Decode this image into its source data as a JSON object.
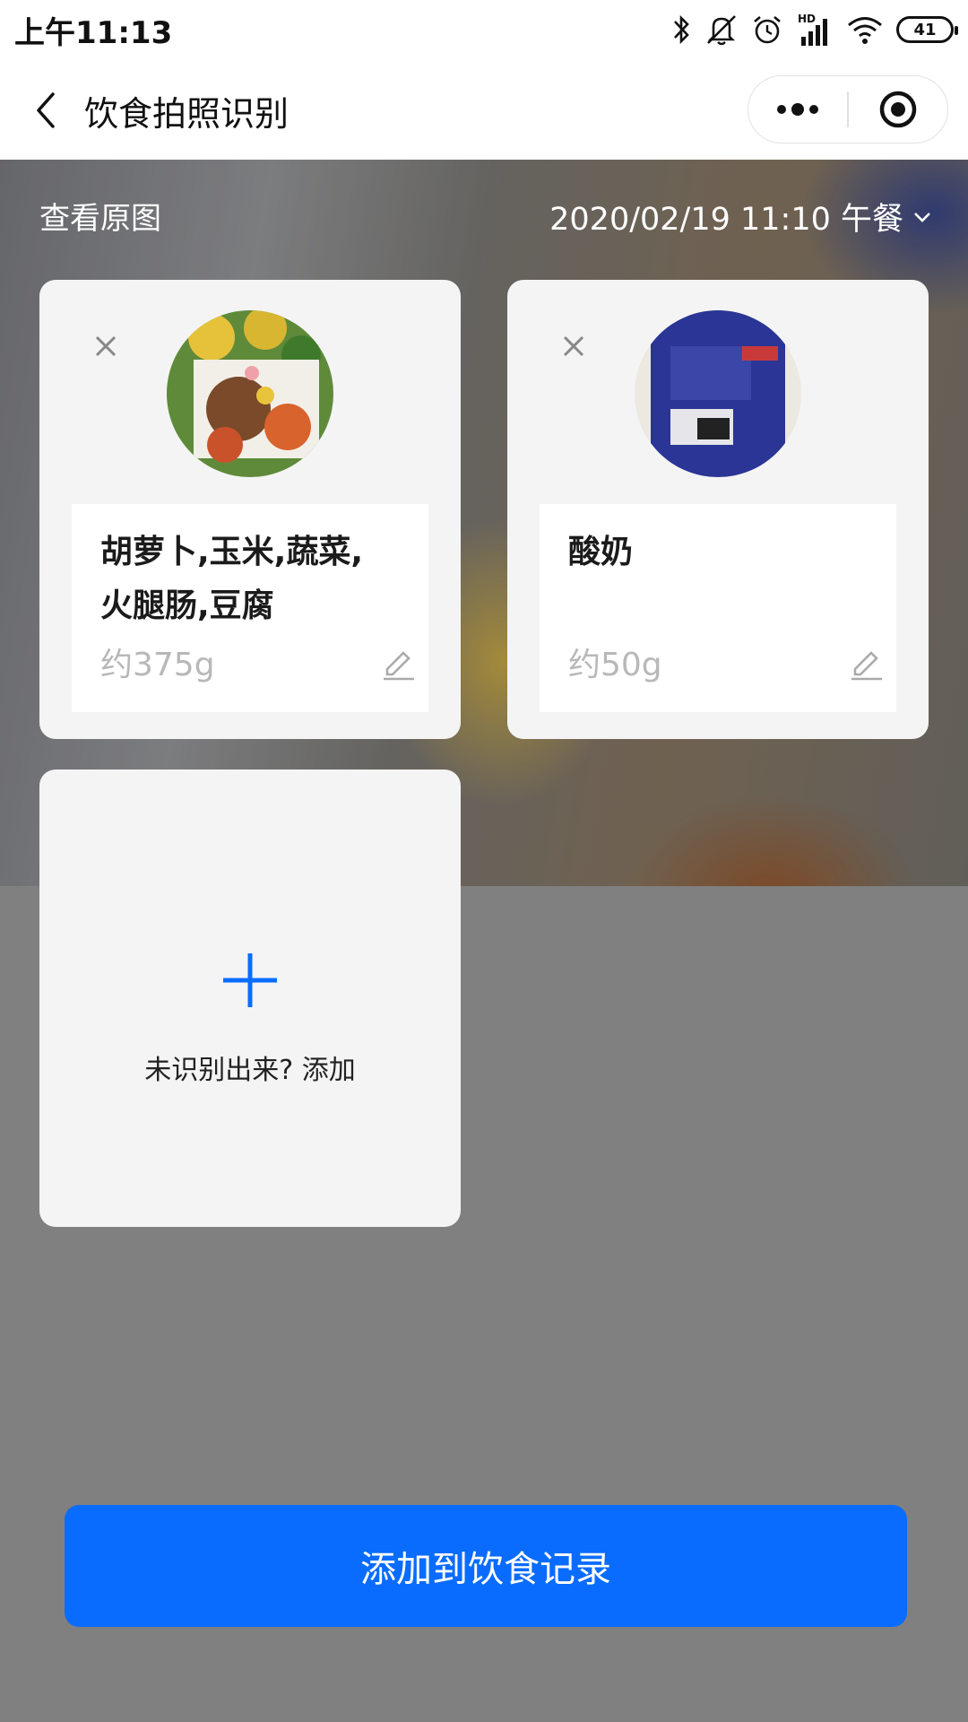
{
  "status_bar": {
    "time": "上午11:13",
    "battery": "41",
    "icons": [
      "bluetooth-icon",
      "mute-icon",
      "alarm-icon",
      "signal-icon",
      "wifi-icon",
      "battery-icon"
    ],
    "hd_label": "HD"
  },
  "nav": {
    "title": "饮食拍照识别",
    "back_icon": "chevron-left-icon",
    "more_icon": "more-dots-icon",
    "close_icon": "target-close-icon"
  },
  "header": {
    "view_original": "查看原图",
    "meal_time": "2020/02/19 11:10 午餐"
  },
  "foods": [
    {
      "name_line1": "胡萝卜,玉米,蔬菜,",
      "name_line2": "火腿肠,豆腐",
      "weight": "约375g"
    },
    {
      "name_line1": "酸奶",
      "name_line2": "",
      "weight": "约50g"
    }
  ],
  "add_card": {
    "label": "未识别出来? 添加"
  },
  "primary_button": {
    "label": "添加到饮食记录"
  },
  "colors": {
    "accent": "#0a6cff",
    "overlay": "#808080",
    "card": "#f4f4f4"
  }
}
